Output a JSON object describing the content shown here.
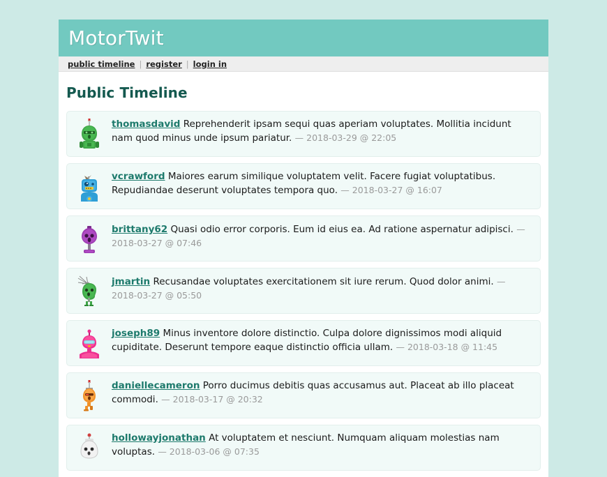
{
  "site": {
    "title": "MotorTwit",
    "accent_teal": "#72c9c0",
    "page_background": "#cdeae6",
    "entry_background": "#f1faf8",
    "heading_color": "#14594f",
    "link_color": "#1d7a6c",
    "date_color": "#9a9a9a"
  },
  "nav": {
    "separator": "|",
    "items": [
      {
        "label": "public timeline"
      },
      {
        "label": "register"
      },
      {
        "label": "login in"
      }
    ]
  },
  "main": {
    "page_title": "Public Timeline"
  },
  "messages": [
    {
      "user": "thomasdavid",
      "text": "Reprehenderit ipsam sequi quas aperiam voluptates. Mollitia incidunt nam quod minus unde ipsum pariatur.",
      "date": "— 2018-03-29 @ 22:05",
      "avatar": "green-antenna-robot-avatar",
      "avatar_color": "#3fa648"
    },
    {
      "user": "vcrawford",
      "text": "Maiores earum similique voluptatem velit. Facere fugiat voluptatibus. Repudiandae deserunt voluptates tempora quo.",
      "date": "— 2018-03-27 @ 16:07",
      "avatar": "blue-boxhead-robot-avatar",
      "avatar_color": "#2f9fd6"
    },
    {
      "user": "brittany62",
      "text": "Quasi odio error corporis. Eum id eius ea. Ad ratione aspernatur adipisci.",
      "date": "— 2018-03-27 @ 07:46",
      "avatar": "purple-bulb-robot-avatar",
      "avatar_color": "#9c3bb0"
    },
    {
      "user": "jmartin",
      "text": "Recusandae voluptates exercitationem sit iure rerum. Quod dolor animi.",
      "date": "— 2018-03-27 @ 05:50",
      "avatar": "green-antenna-array-robot-avatar",
      "avatar_color": "#3fa648"
    },
    {
      "user": "joseph89",
      "text": "Minus inventore dolore distinctio. Culpa dolore dignissimos modi aliquid cupiditate. Deserunt tempore eaque distinctio officia ullam.",
      "date": "— 2018-03-18 @ 11:45",
      "avatar": "pink-visor-robot-avatar",
      "avatar_color": "#ec2f8f"
    },
    {
      "user": "daniellecameron",
      "text": "Porro ducimus debitis quas accusamus aut. Placeat ab illo placeat commodi.",
      "date": "— 2018-03-17 @ 20:32",
      "avatar": "orange-antenna-robot-avatar",
      "avatar_color": "#f0912a"
    },
    {
      "user": "hollowayjonathan",
      "text": "At voluptatem et nesciunt. Numquam aliquam molestias nam voluptas.",
      "date": "— 2018-03-06 @ 07:35",
      "avatar": "white-round-robot-avatar",
      "avatar_color": "#e9e9e9"
    }
  ]
}
